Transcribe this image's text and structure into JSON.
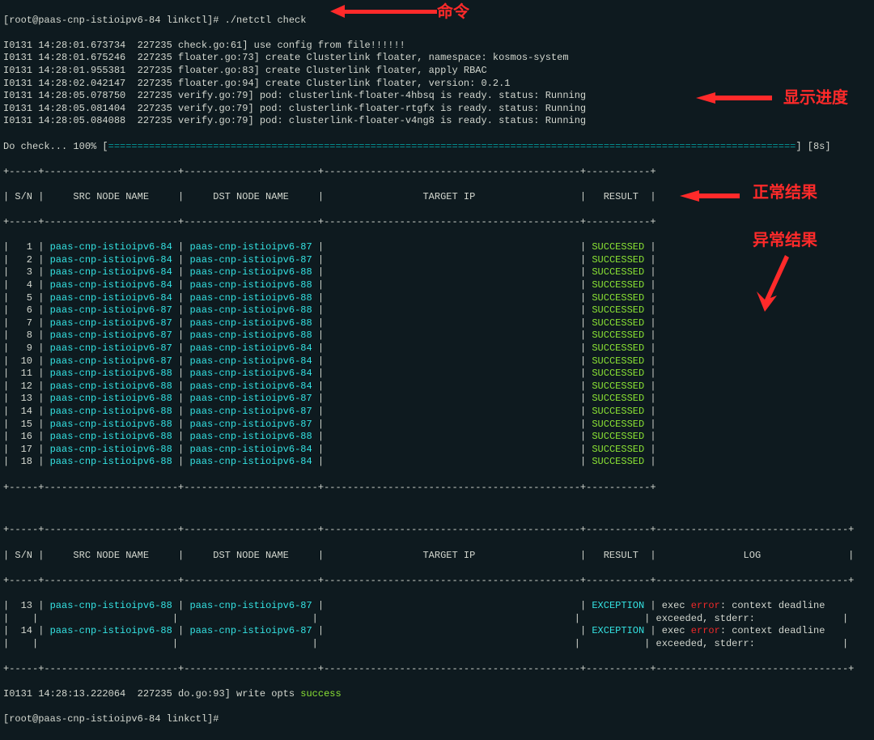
{
  "prompt_line": "[root@paas-cnp-istioipv6-84 linkctl]# ./netctl check",
  "logs": [
    "I0131 14:28:01.673734  227235 check.go:61] use config from file!!!!!!",
    "I0131 14:28:01.675246  227235 floater.go:73] create Clusterlink floater, namespace: kosmos-system",
    "I0131 14:28:01.955381  227235 floater.go:83] create Clusterlink floater, apply RBAC",
    "I0131 14:28:02.042147  227235 floater.go:94] create Clusterlink floater, version: 0.2.1",
    "I0131 14:28:05.078750  227235 verify.go:79] pod: clusterlink-floater-4hbsq is ready. status: Running",
    "I0131 14:28:05.081404  227235 verify.go:79] pod: clusterlink-floater-rtgfx is ready. status: Running",
    "I0131 14:28:05.084088  227235 verify.go:79] pod: clusterlink-floater-v4ng8 is ready. status: Running"
  ],
  "progress": {
    "prefix": "Do check... 100% [",
    "bar": "======================================================================================================================",
    "suffix": "] [8s]"
  },
  "table1": {
    "headers": [
      "S/N",
      "SRC NODE NAME",
      "DST NODE NAME",
      "TARGET IP",
      "RESULT"
    ],
    "rows": [
      {
        "n": "1",
        "src": "paas-cnp-istioipv6-84",
        "dst": "paas-cnp-istioipv6-87",
        "r": "SUCCESSED"
      },
      {
        "n": "2",
        "src": "paas-cnp-istioipv6-84",
        "dst": "paas-cnp-istioipv6-87",
        "r": "SUCCESSED"
      },
      {
        "n": "3",
        "src": "paas-cnp-istioipv6-84",
        "dst": "paas-cnp-istioipv6-88",
        "r": "SUCCESSED"
      },
      {
        "n": "4",
        "src": "paas-cnp-istioipv6-84",
        "dst": "paas-cnp-istioipv6-88",
        "r": "SUCCESSED"
      },
      {
        "n": "5",
        "src": "paas-cnp-istioipv6-84",
        "dst": "paas-cnp-istioipv6-88",
        "r": "SUCCESSED"
      },
      {
        "n": "6",
        "src": "paas-cnp-istioipv6-87",
        "dst": "paas-cnp-istioipv6-88",
        "r": "SUCCESSED"
      },
      {
        "n": "7",
        "src": "paas-cnp-istioipv6-87",
        "dst": "paas-cnp-istioipv6-88",
        "r": "SUCCESSED"
      },
      {
        "n": "8",
        "src": "paas-cnp-istioipv6-87",
        "dst": "paas-cnp-istioipv6-88",
        "r": "SUCCESSED"
      },
      {
        "n": "9",
        "src": "paas-cnp-istioipv6-87",
        "dst": "paas-cnp-istioipv6-84",
        "r": "SUCCESSED"
      },
      {
        "n": "10",
        "src": "paas-cnp-istioipv6-87",
        "dst": "paas-cnp-istioipv6-84",
        "r": "SUCCESSED"
      },
      {
        "n": "11",
        "src": "paas-cnp-istioipv6-88",
        "dst": "paas-cnp-istioipv6-84",
        "r": "SUCCESSED"
      },
      {
        "n": "12",
        "src": "paas-cnp-istioipv6-88",
        "dst": "paas-cnp-istioipv6-84",
        "r": "SUCCESSED"
      },
      {
        "n": "13",
        "src": "paas-cnp-istioipv6-88",
        "dst": "paas-cnp-istioipv6-87",
        "r": "SUCCESSED"
      },
      {
        "n": "14",
        "src": "paas-cnp-istioipv6-88",
        "dst": "paas-cnp-istioipv6-87",
        "r": "SUCCESSED"
      },
      {
        "n": "15",
        "src": "paas-cnp-istioipv6-88",
        "dst": "paas-cnp-istioipv6-87",
        "r": "SUCCESSED"
      },
      {
        "n": "16",
        "src": "paas-cnp-istioipv6-88",
        "dst": "paas-cnp-istioipv6-88",
        "r": "SUCCESSED"
      },
      {
        "n": "17",
        "src": "paas-cnp-istioipv6-88",
        "dst": "paas-cnp-istioipv6-84",
        "r": "SUCCESSED"
      },
      {
        "n": "18",
        "src": "paas-cnp-istioipv6-88",
        "dst": "paas-cnp-istioipv6-84",
        "r": "SUCCESSED"
      }
    ]
  },
  "table2": {
    "headers": [
      "S/N",
      "SRC NODE NAME",
      "DST NODE NAME",
      "TARGET IP",
      "RESULT",
      "LOG"
    ],
    "rows": [
      {
        "n": "13",
        "src": "paas-cnp-istioipv6-88",
        "dst": "paas-cnp-istioipv6-87",
        "r": "EXCEPTION",
        "log_pre": "exec ",
        "log_err": "error",
        "log_post": ": context deadline\n|    |                       |                       |                                            |           | exceeded, stderr:"
      },
      {
        "n": "14",
        "src": "paas-cnp-istioipv6-88",
        "dst": "paas-cnp-istioipv6-87",
        "r": "EXCEPTION",
        "log_pre": "exec ",
        "log_err": "error",
        "log_post": ": context deadline\n|    |                       |                       |                                            |           | exceeded, stderr:"
      }
    ]
  },
  "footer_log": "I0131 14:28:13.222064  227235 do.go:93] write opts ",
  "footer_success": "success",
  "footer_prompt": "[root@paas-cnp-istioipv6-84 linkctl]# ",
  "annotations": {
    "cmd": "命令",
    "progress": "显示进度",
    "normal": "正常结果",
    "exception": "异常结果"
  },
  "sep1": "+-----+-----------------------+-----------------------+--------------------------------------------+-----------+",
  "sep2": "+-----+-----------------------+-----------------------+--------------------------------------------+-----------+---------------------------------+"
}
